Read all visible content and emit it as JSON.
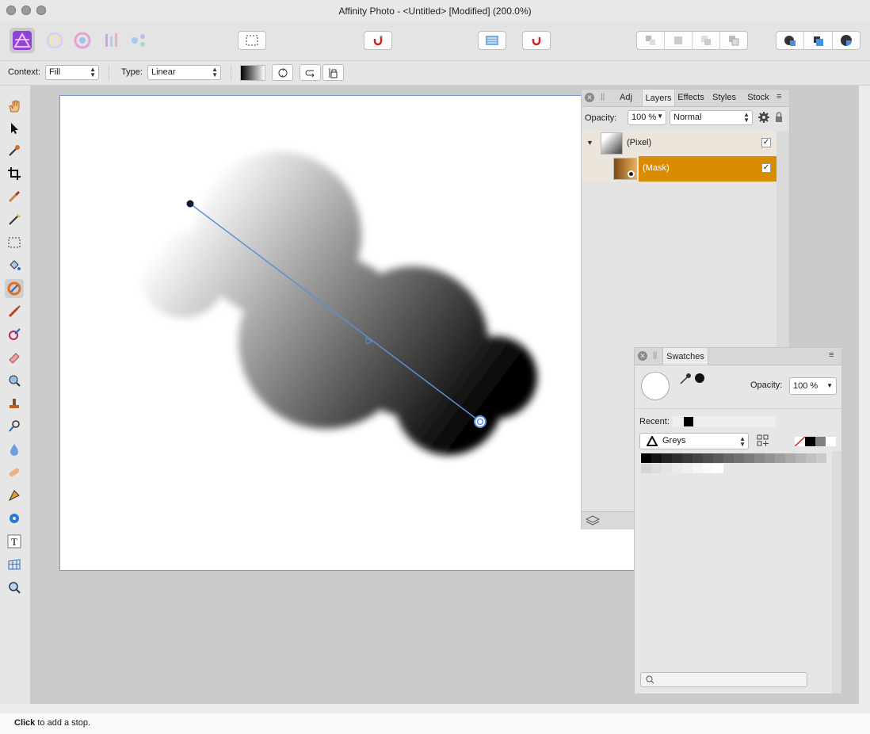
{
  "window": {
    "title": "Affinity Photo - <Untitled> [Modified] (200.0%)"
  },
  "context_bar": {
    "context_label": "Context:",
    "context_value": "Fill",
    "type_label": "Type:",
    "type_value": "Linear"
  },
  "layers_panel": {
    "tabs": [
      "Adj",
      "Layers",
      "Effects",
      "Styles",
      "Stock"
    ],
    "active_tab": "Layers",
    "opacity_label": "Opacity:",
    "opacity_value": "100 %",
    "blend_mode": "Normal",
    "layers": [
      {
        "name": "(Pixel)",
        "checked": true
      },
      {
        "name": "(Mask)",
        "checked": true,
        "selected": true
      }
    ]
  },
  "swatches_panel": {
    "tab": "Swatches",
    "opacity_label": "Opacity:",
    "opacity_value": "100 %",
    "recent_label": "Recent:",
    "palette_name": "Greys"
  },
  "status": {
    "bold": "Click",
    "text": " to add a stop."
  },
  "colors": {
    "accent": "#5b8fd6",
    "selected_layer": "#d98c00",
    "canvas_border": "#6a9ad8"
  }
}
